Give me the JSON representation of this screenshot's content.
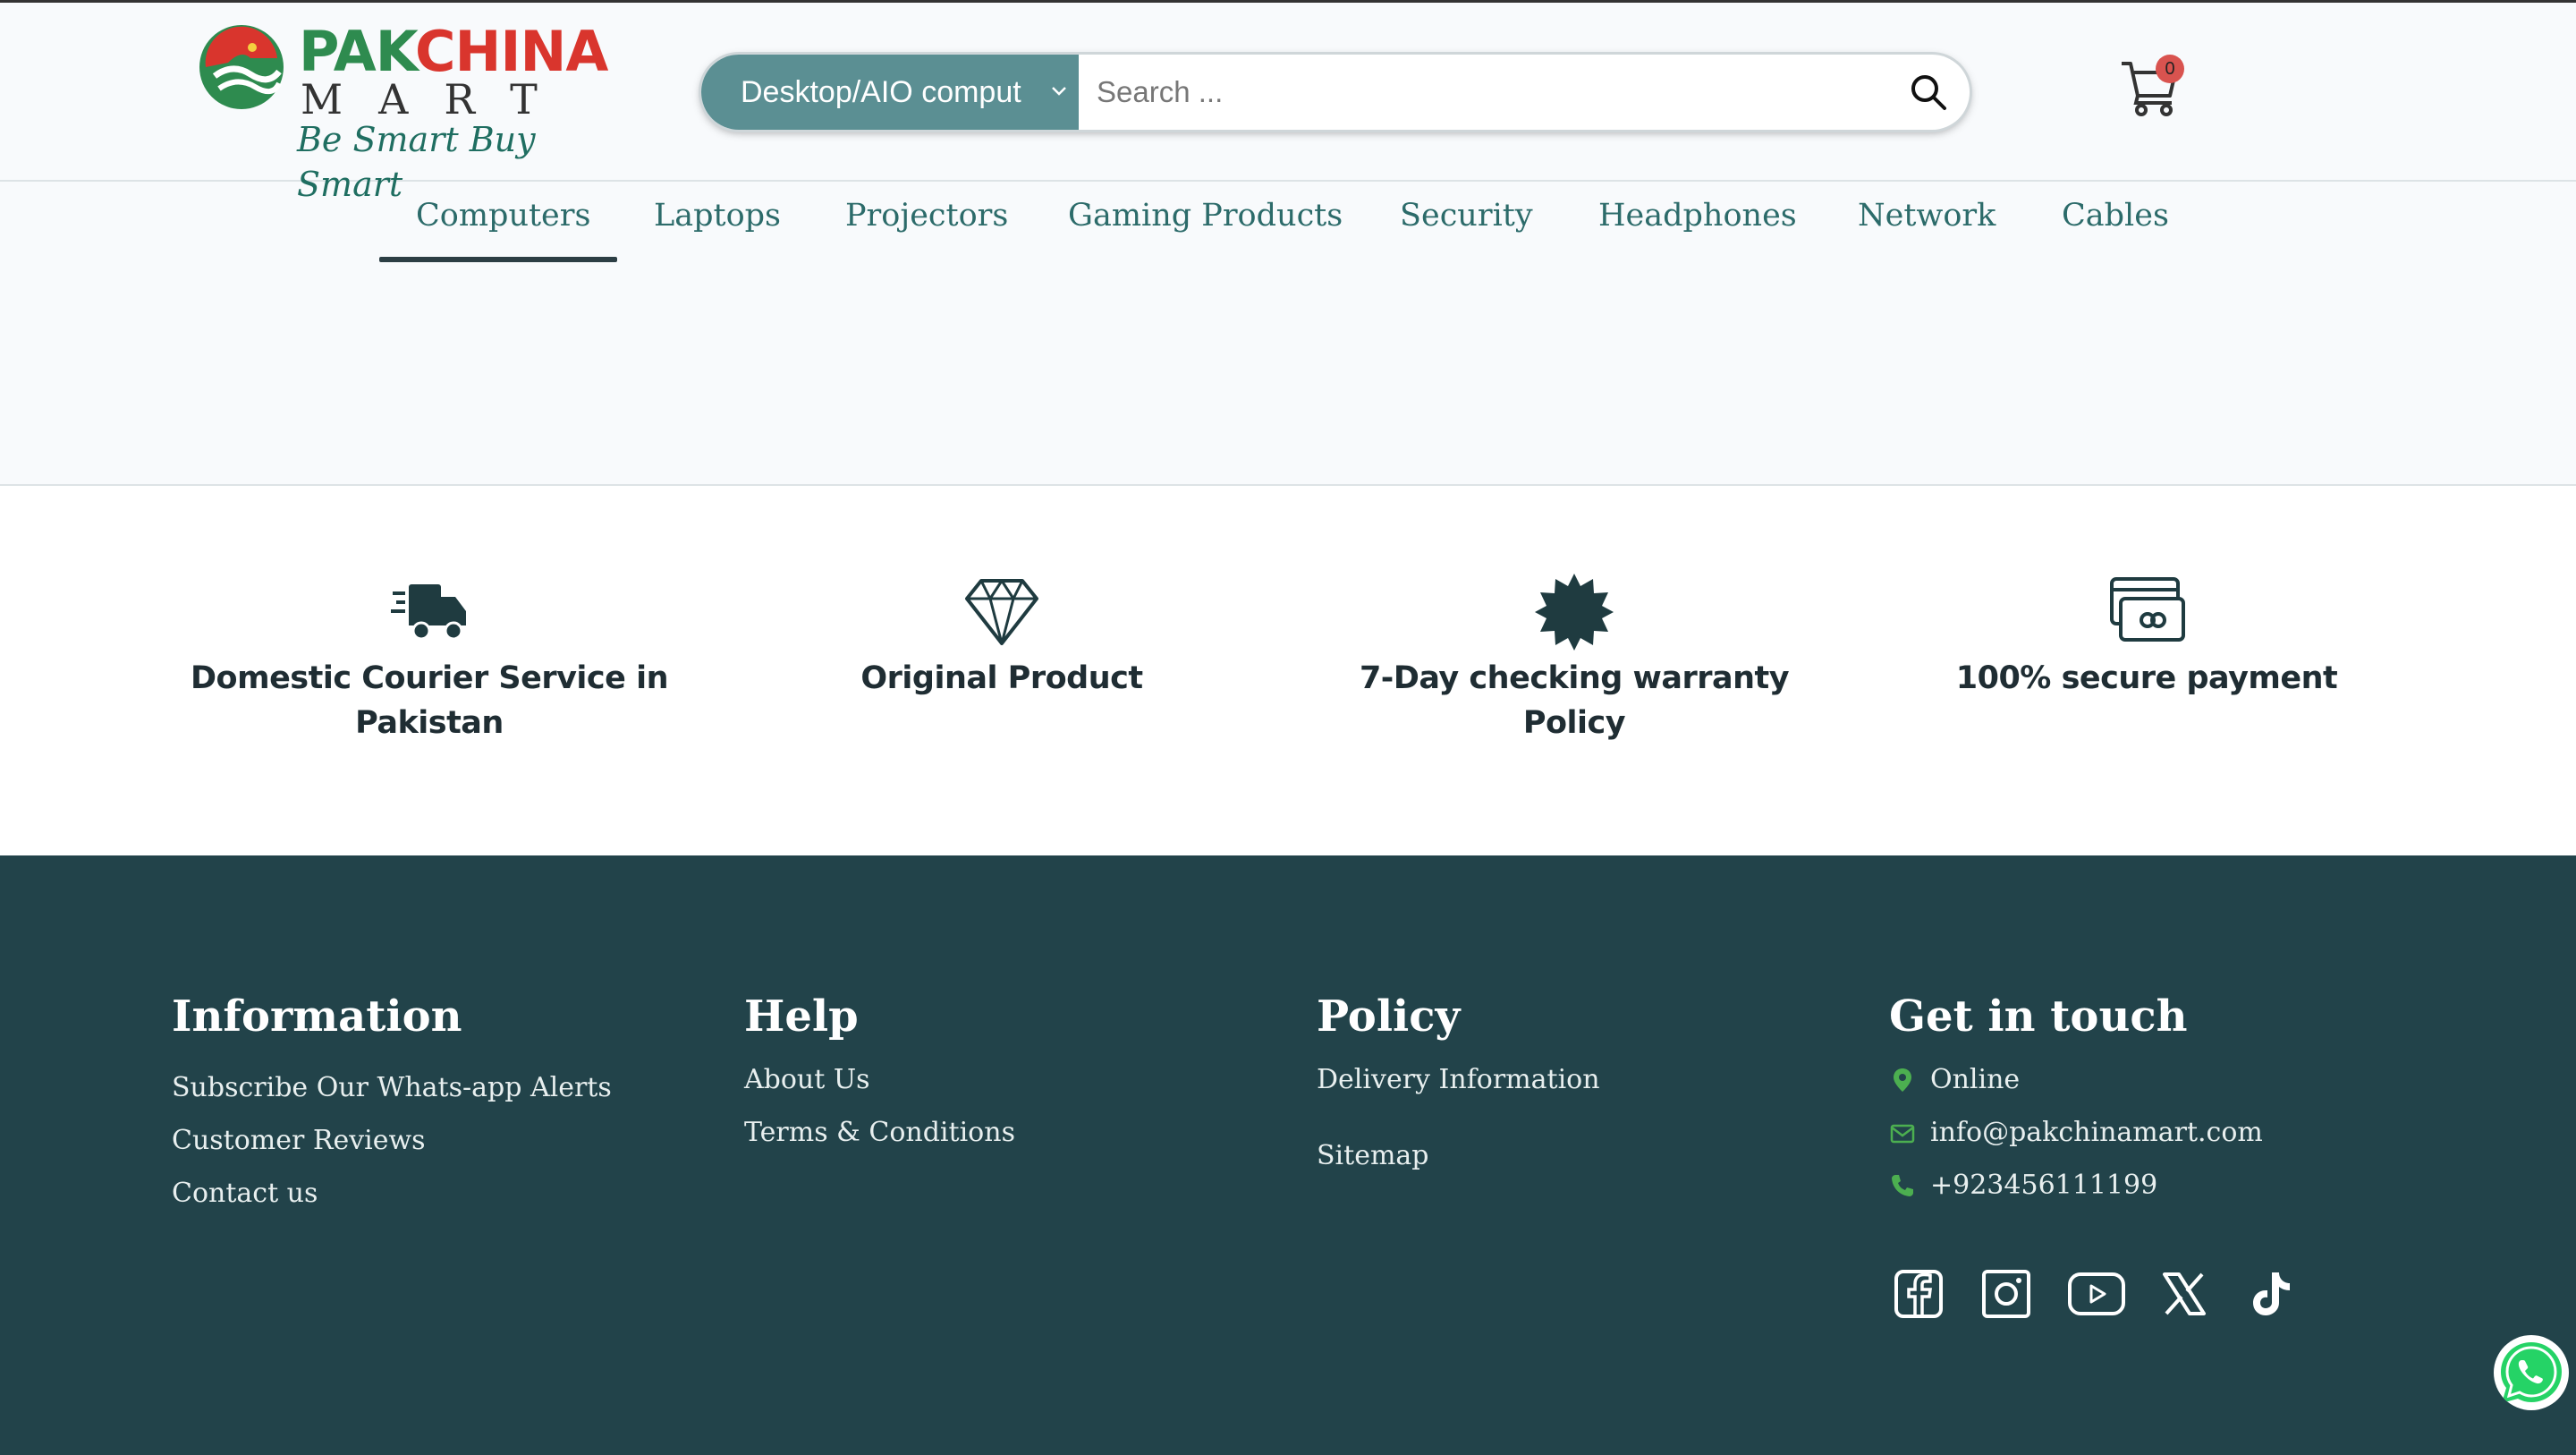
{
  "header": {
    "logo": {
      "line1_a": "PAK",
      "line1_b": "CHINA",
      "line2": "MART",
      "tagline": "Be Smart Buy Smart"
    },
    "search": {
      "category_selected": "Desktop/AIO comput",
      "placeholder": "Search ..."
    },
    "cart": {
      "count": "0"
    }
  },
  "nav": {
    "items": [
      {
        "label": "Computers",
        "active": true
      },
      {
        "label": "Laptops"
      },
      {
        "label": "Projectors"
      },
      {
        "label": "Gaming Products"
      },
      {
        "label": "Security"
      },
      {
        "label": "Headphones"
      },
      {
        "label": "Network"
      },
      {
        "label": "Cables"
      }
    ]
  },
  "features": [
    {
      "icon": "delivery-truck-icon",
      "text": "Domestic Courier Service in Pakistan"
    },
    {
      "icon": "diamond-icon",
      "text": "Original Product"
    },
    {
      "icon": "badge-icon",
      "text": "7-Day checking warranty Policy"
    },
    {
      "icon": "secure-card-icon",
      "text": "100% secure payment"
    }
  ],
  "footer": {
    "information": {
      "title": "Information",
      "links": [
        "Subscribe Our Whats-app Alerts",
        "Customer Reviews",
        "Contact us"
      ]
    },
    "help": {
      "title": "Help",
      "links": [
        "About Us",
        "Terms & Conditions"
      ]
    },
    "policy": {
      "title": "Policy",
      "links": [
        "Delivery Information",
        "Sitemap"
      ]
    },
    "contact": {
      "title": "Get in touch",
      "location": "Online",
      "email": "info@pakchinamart.com",
      "phone": "+923456111199"
    },
    "social": [
      "facebook-icon",
      "instagram-icon",
      "youtube-icon",
      "x-icon",
      "tiktok-icon"
    ]
  },
  "colors": {
    "accent": "#5b8f93",
    "nav_text": "#2c6b6a",
    "footer_bg": "#22434a",
    "contact_icon": "#4caf50",
    "whatsapp": "#25d366"
  }
}
